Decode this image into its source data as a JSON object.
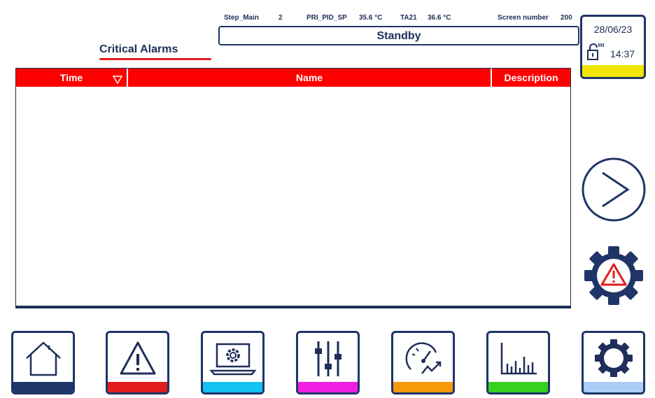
{
  "status": {
    "step_main_label": "Step_Main",
    "step_main_value": "2",
    "pri_pid_sp_label": "PRI_PID_SP",
    "pri_pid_sp_value": "35.6 °C",
    "ta21_label": "TA21",
    "ta21_value": "36.6 °C",
    "screen_number_label": "Screen number",
    "screen_number_value": "200",
    "machine_state": "Standby"
  },
  "datetime": {
    "date": "28/06/23",
    "time": "14:37"
  },
  "page": {
    "title": "Critical Alarms"
  },
  "table": {
    "columns": [
      "Time",
      "Name",
      "Description"
    ],
    "rows": []
  },
  "nav": {
    "items": [
      {
        "icon": "home-icon",
        "color": "#1f3568"
      },
      {
        "icon": "warning-icon",
        "color": "#e31b1b"
      },
      {
        "icon": "monitor-gear-icon",
        "color": "#13c2f0"
      },
      {
        "icon": "sliders-icon",
        "color": "#f01ee0"
      },
      {
        "icon": "gauge-trend-icon",
        "color": "#f79a0a"
      },
      {
        "icon": "bar-chart-icon",
        "color": "#35d11e"
      },
      {
        "icon": "gear-icon",
        "color": "#a9cdf5"
      }
    ]
  },
  "colors": {
    "header_red": "#ff0000",
    "navy": "#1f3568",
    "accent_yellow": "#f2e600"
  }
}
